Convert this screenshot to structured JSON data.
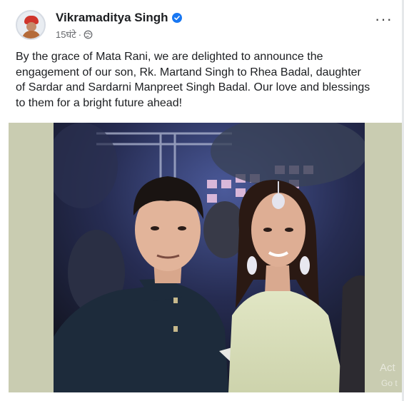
{
  "post": {
    "author": "Vikramaditya Singh",
    "time": "15घंटे",
    "separator": "·",
    "caption": "By the grace of Mata Rani, we are delighted to announce the engagement of our son, Rk. Martand Singh to Rhea Badal, daughter of Sardar and Sardarni Manpreet Singh Badal. Our love and blessings to them for a bright future ahead!",
    "more_label": "···"
  },
  "photo": {
    "watermark_line1": "Act",
    "watermark_line2": "Go t"
  },
  "colors": {
    "verified_blue": "#1877f2",
    "photo_band": "#c9ccb1"
  },
  "icons": [
    "verified-badge-icon",
    "globe-icon",
    "more-options-icon"
  ]
}
